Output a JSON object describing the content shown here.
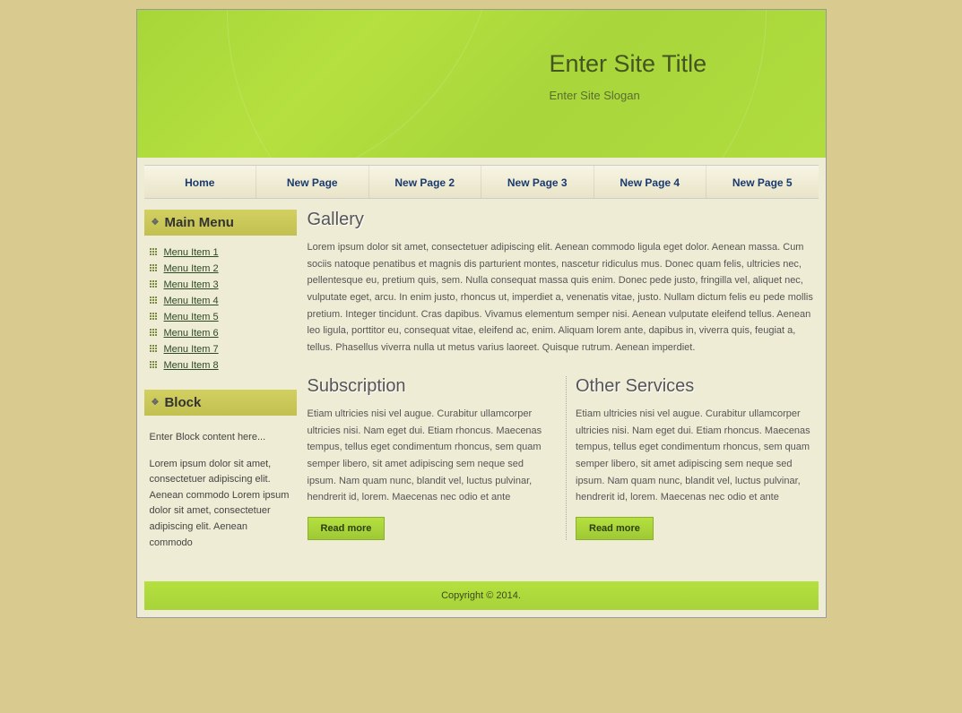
{
  "header": {
    "title": "Enter Site Title",
    "slogan": "Enter Site Slogan"
  },
  "nav": {
    "items": [
      "Home",
      "New Page",
      "New Page 2",
      "New Page 3",
      "New Page 4",
      "New Page 5"
    ]
  },
  "sidebar": {
    "menu_title": "Main Menu",
    "menu_items": [
      "Menu Item 1",
      "Menu Item 2",
      "Menu Item 3",
      "Menu Item 4",
      "Menu Item 5",
      "Menu Item 6",
      "Menu Item 7",
      "Menu Item 8"
    ],
    "block_title": "Block",
    "block_intro": "Enter Block content here...",
    "block_text": "Lorem ipsum dolor sit amet, consectetuer adipiscing elit. Aenean commodo Lorem ipsum dolor sit amet, consectetuer adipiscing elit. Aenean commodo"
  },
  "main": {
    "gallery_title": "Gallery",
    "gallery_text": "Lorem ipsum dolor sit amet, consectetuer adipiscing elit. Aenean commodo ligula eget dolor. Aenean massa. Cum sociis natoque penatibus et magnis dis parturient montes, nascetur ridiculus mus. Donec quam felis, ultricies nec, pellentesque eu, pretium quis, sem. Nulla consequat massa quis enim. Donec pede justo, fringilla vel, aliquet nec, vulputate eget, arcu. In enim justo, rhoncus ut, imperdiet a, venenatis vitae, justo. Nullam dictum felis eu pede mollis pretium. Integer tincidunt. Cras dapibus. Vivamus elementum semper nisi. Aenean vulputate eleifend tellus. Aenean leo ligula, porttitor eu, consequat vitae, eleifend ac, enim. Aliquam lorem ante, dapibus in, viverra quis, feugiat a, tellus. Phasellus viverra nulla ut metus varius laoreet. Quisque rutrum. Aenean imperdiet.",
    "subscription_title": "Subscription",
    "subscription_text": "Etiam ultricies nisi vel augue. Curabitur ullamcorper ultricies nisi. Nam eget dui. Etiam rhoncus. Maecenas tempus, tellus eget condimentum rhoncus, sem quam semper libero, sit amet adipiscing sem neque sed ipsum. Nam quam nunc, blandit vel, luctus pulvinar, hendrerit id, lorem. Maecenas nec odio et ante",
    "subscription_button": "Read more",
    "services_title": "Other Services",
    "services_text": "Etiam ultricies nisi vel augue. Curabitur ullamcorper ultricies nisi. Nam eget dui. Etiam rhoncus. Maecenas tempus, tellus eget condimentum rhoncus, sem quam semper libero, sit amet adipiscing sem neque sed ipsum. Nam quam nunc, blandit vel, luctus pulvinar, hendrerit id, lorem. Maecenas nec odio et ante",
    "services_button": "Read more"
  },
  "footer": {
    "copyright": "Copyright © 2014."
  }
}
